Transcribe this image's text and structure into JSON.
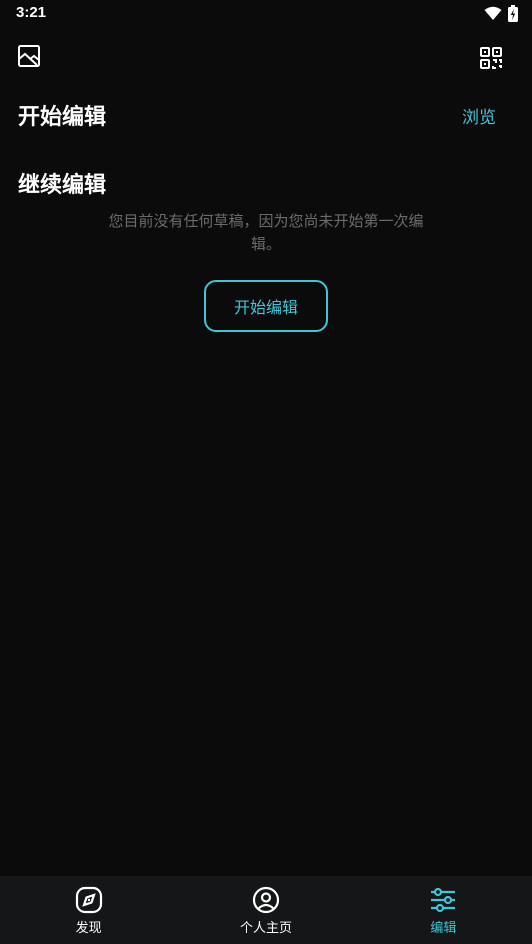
{
  "status_bar": {
    "time": "3:21",
    "icons": [
      "wifi-icon",
      "battery-charging-icon"
    ]
  },
  "topbar": {
    "left_icon": "image-icon",
    "right_icon": "qr-code-icon"
  },
  "start_section": {
    "title": "开始编辑",
    "browse_label": "浏览"
  },
  "continue_section": {
    "title": "继续编辑",
    "empty_message": "您目前没有任何草稿，因为您尚未开始第一次编辑。",
    "start_button_label": "开始编辑"
  },
  "bottom_nav": {
    "items": [
      {
        "label": "发现",
        "icon": "compass-icon",
        "active": false
      },
      {
        "label": "个人主页",
        "icon": "user-profile-icon",
        "active": false
      },
      {
        "label": "编辑",
        "icon": "sliders-icon",
        "active": true
      }
    ]
  },
  "colors": {
    "background": "#0b0b0c",
    "accent": "#3ec6d6",
    "muted_text": "#6b6b6b",
    "nav_background": "#141617"
  }
}
